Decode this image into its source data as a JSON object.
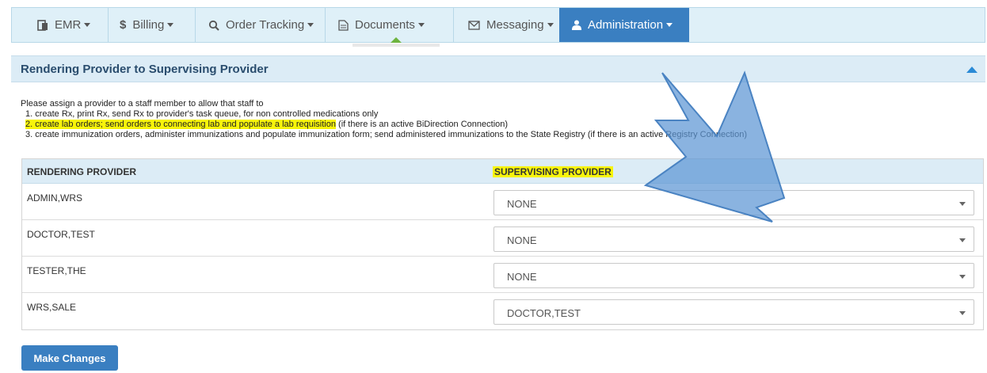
{
  "nav": {
    "items": [
      {
        "label": "EMR",
        "icon": "emr-document-icon"
      },
      {
        "label": "Billing",
        "icon": "dollar-icon"
      },
      {
        "label": "Order Tracking",
        "icon": "search-icon"
      },
      {
        "label": "Documents",
        "icon": "document-icon"
      },
      {
        "label": "Messaging",
        "icon": "envelope-icon"
      },
      {
        "label": "Administration",
        "icon": "user-icon"
      }
    ],
    "active": "Administration",
    "accent_color": "#3a7fc1"
  },
  "panel": {
    "title": "Rendering Provider to Supervising Provider"
  },
  "intro": {
    "lead": "Please assign a provider to a staff member to allow that staff to",
    "items": [
      "1. create Rx, print Rx, send Rx to provider's task queue, for non controlled medications only",
      "2. create lab orders; send orders to connecting lab and populate a lab requisition",
      "(if there is an active BiDirection Connection)",
      "3. create immunization orders, administer immunizations and populate immunization form; send administered immunizations to the State Registry",
      "(if there is an active Registry Connection)"
    ],
    "highlight_color": "#f7f40a"
  },
  "table": {
    "headers": [
      "RENDERING PROVIDER",
      "SUPERVISING PROVIDER"
    ],
    "rows": [
      {
        "rendering": "ADMIN,WRS",
        "supervising": "NONE"
      },
      {
        "rendering": "DOCTOR,TEST",
        "supervising": "NONE"
      },
      {
        "rendering": "TESTER,THE",
        "supervising": "NONE"
      },
      {
        "rendering": "WRS,SALE",
        "supervising": "DOCTOR,TEST"
      }
    ]
  },
  "actions": {
    "submit_label": "Make Changes"
  },
  "annotation": {
    "arrow_color": "#6a9fd8"
  }
}
